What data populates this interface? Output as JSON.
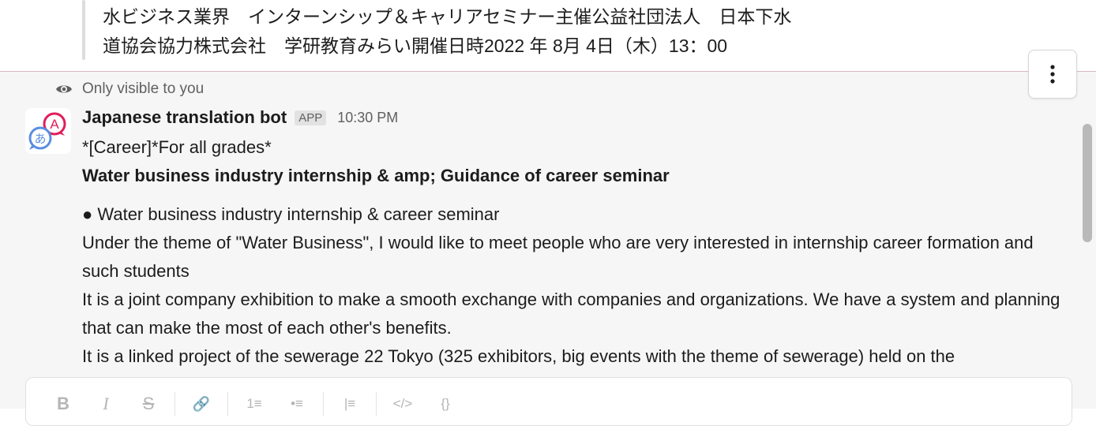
{
  "quoted_message": {
    "line1": "水ビジネス業界　インターンシップ＆キャリアセミナー主催公益社団法人　日本下水",
    "line2": "道協会協力株式会社　学研教育みらい開催日時2022 年 8月 4日（木）13：00"
  },
  "visibility": {
    "label": "Only visible to you",
    "icon": "eye-icon"
  },
  "message": {
    "sender": "Japanese translation bot",
    "badge": "APP",
    "time": "10:30 PM",
    "avatar_letters": {
      "top": "A",
      "bottom": "あ"
    },
    "lines": [
      "*[Career]*For all grades*",
      "Water business industry internship & amp; Guidance of career seminar",
      "● Water business industry internship & career seminar",
      "Under the theme of \"Water Business\", I would like to meet people who are very interested in internship career formation and such students",
      "It is a joint company exhibition to make a smooth exchange with companies and organizations. We have a system and planning that can make the most of each other's benefits.",
      "It is a linked project of the sewerage 22 Tokyo (325 exhibitors, big events with the theme of sewerage) held on the"
    ]
  },
  "composer": {
    "toolbar": [
      "bold-icon",
      "italic-icon",
      "strikethrough-icon",
      "link-icon",
      "ordered-list-icon",
      "bulleted-list-icon",
      "blockquote-icon",
      "code-icon",
      "code-block-icon"
    ],
    "toolbar_glyphs": [
      "B",
      "I",
      "S",
      "🔗",
      "1≡",
      "•≡",
      "|≡",
      "</>",
      "{}"
    ]
  },
  "colors": {
    "accent_pink": "#e01e5a",
    "accent_blue": "#5a8ee0",
    "divider": "#d7b7c9"
  }
}
